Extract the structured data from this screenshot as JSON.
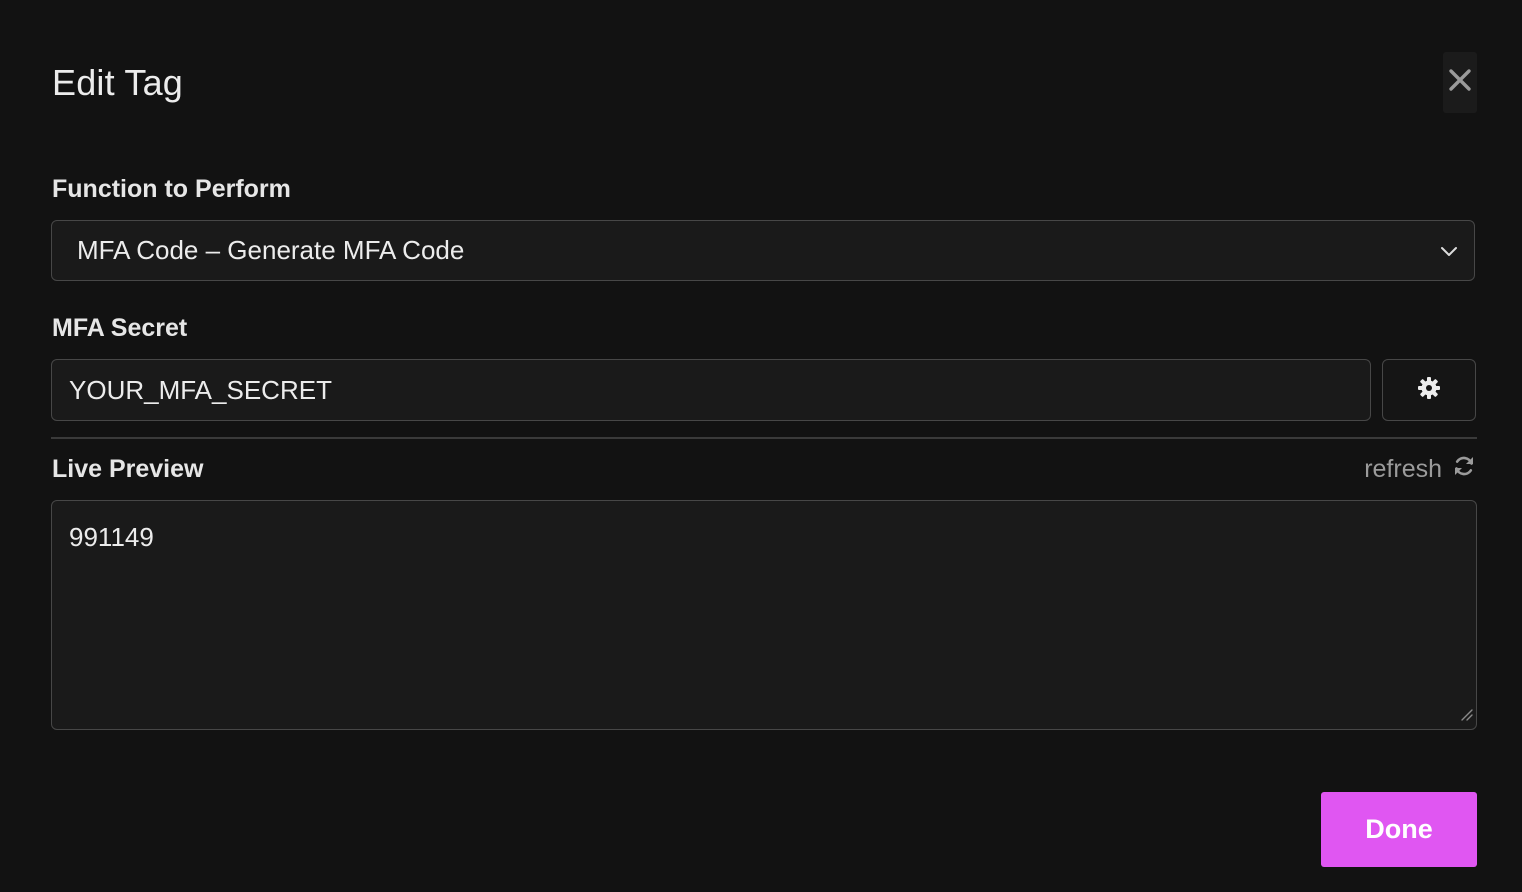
{
  "dialog": {
    "title": "Edit Tag",
    "close_icon": "close-icon"
  },
  "function_field": {
    "label": "Function to Perform",
    "selected_value": "MFA Code – Generate MFA Code",
    "icon": "chevron-down-icon"
  },
  "secret_field": {
    "label": "MFA Secret",
    "value": "YOUR_MFA_SECRET",
    "settings_icon": "gear-icon"
  },
  "preview": {
    "label": "Live Preview",
    "refresh_label": "refresh",
    "refresh_icon": "refresh-icon",
    "value": "991149"
  },
  "actions": {
    "done_label": "Done"
  },
  "colors": {
    "background": "#121212",
    "field_background": "#1a1a1a",
    "border": "#474747",
    "accent": "#e056f2"
  }
}
